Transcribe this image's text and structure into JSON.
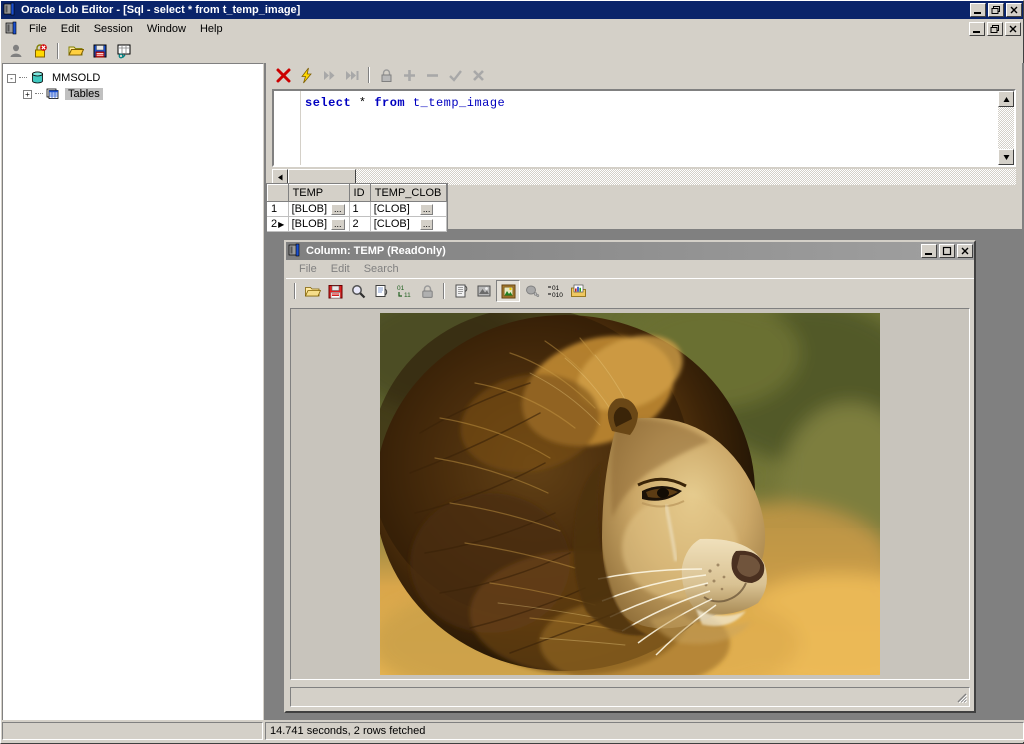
{
  "window": {
    "title": "Oracle Lob Editor - [Sql - select * from t_temp_image]",
    "app_icon": "lob-editor-icon",
    "buttons": {
      "minimize": "_",
      "maximize": "□",
      "close": "X"
    }
  },
  "menubar": {
    "mdi_icon": "document-icon",
    "items": [
      {
        "label": "File",
        "name": "menu-file"
      },
      {
        "label": "Edit",
        "name": "menu-edit"
      },
      {
        "label": "Session",
        "name": "menu-session"
      },
      {
        "label": "Window",
        "name": "menu-window"
      },
      {
        "label": "Help",
        "name": "menu-help"
      }
    ],
    "mdi_buttons": {
      "minimize": "_",
      "restore": "▭",
      "close": "X"
    }
  },
  "toolbar": {
    "buttons": [
      {
        "name": "user-icon",
        "title": "User"
      },
      {
        "name": "disconnect-lock-icon",
        "title": "Disconnect"
      },
      {
        "name": "open-folder-icon",
        "title": "Open"
      },
      {
        "name": "save-floppy-icon",
        "title": "Save"
      },
      {
        "name": "sql-grid-icon",
        "title": "New SQL"
      }
    ]
  },
  "tree": {
    "root": {
      "label": "MMSOLD",
      "icon": "database-icon",
      "expander": "-"
    },
    "child": {
      "label": "Tables",
      "icon": "tables-icon",
      "expander": "+",
      "selected": true
    }
  },
  "sql_window": {
    "toolbar": [
      {
        "name": "cancel-icon",
        "title": "Cancel"
      },
      {
        "name": "execute-lightning-icon",
        "title": "Execute"
      },
      {
        "name": "fetch-next-icon",
        "title": "Fetch next"
      },
      {
        "name": "fetch-all-icon",
        "title": "Fetch all"
      },
      {
        "name": "lock-icon",
        "title": "Lock"
      },
      {
        "name": "insert-plus-icon",
        "title": "Insert row"
      },
      {
        "name": "delete-minus-icon",
        "title": "Delete row"
      },
      {
        "name": "commit-check-icon",
        "title": "Commit"
      },
      {
        "name": "rollback-x-icon",
        "title": "Rollback"
      }
    ],
    "query_tokens": [
      {
        "text": "select",
        "kind": "keyword"
      },
      {
        "text": " ",
        "kind": "plain"
      },
      {
        "text": "*",
        "kind": "operator"
      },
      {
        "text": " ",
        "kind": "plain"
      },
      {
        "text": "from",
        "kind": "keyword"
      },
      {
        "text": " ",
        "kind": "plain"
      },
      {
        "text": "t_temp_image",
        "kind": "identifier"
      }
    ],
    "query_text": "select * from t_temp_image"
  },
  "grid": {
    "columns": [
      "TEMP",
      "ID",
      "TEMP_CLOB"
    ],
    "rows": [
      {
        "num": "1",
        "marker": "",
        "TEMP": "[BLOB]",
        "ID": "1",
        "TEMP_CLOB": "[CLOB]"
      },
      {
        "num": "2",
        "marker": "▶",
        "TEMP": "[BLOB]",
        "ID": "2",
        "TEMP_CLOB": "[CLOB]"
      }
    ],
    "ellipsis_label": "..."
  },
  "child_window": {
    "title": "Column: TEMP  (ReadOnly)",
    "icon": "lob-editor-icon",
    "buttons": {
      "minimize": "_",
      "maximize": "□",
      "close": "X"
    },
    "menu": [
      {
        "label": "File",
        "name": "child-menu-file"
      },
      {
        "label": "Edit",
        "name": "child-menu-edit"
      },
      {
        "label": "Search",
        "name": "child-menu-search"
      }
    ],
    "toolbar": [
      {
        "name": "open-folder-icon",
        "title": "Load from file"
      },
      {
        "name": "save-floppy-icon",
        "title": "Save to file"
      },
      {
        "name": "find-magnifier-icon",
        "title": "Find"
      },
      {
        "name": "copy-page-icon",
        "title": "Copy"
      },
      {
        "name": "convert-binary-icon",
        "title": "Convert"
      },
      {
        "name": "lock-icon",
        "title": "Read only"
      },
      {
        "name": "print-icon",
        "title": "Print"
      },
      {
        "name": "paint-edit-icon",
        "title": "Edit image"
      },
      {
        "name": "image-view-icon",
        "title": "Image view",
        "pressed": true
      },
      {
        "name": "object-view-icon",
        "title": "Object view"
      },
      {
        "name": "binary-view-icon",
        "title": "Binary view"
      },
      {
        "name": "report-view-icon",
        "title": "Report view"
      }
    ],
    "image": {
      "name": "lion-photo",
      "alt": "Lion portrait photograph"
    }
  },
  "statusbar": {
    "left": "",
    "right": "14.741 seconds,  2 rows fetched"
  },
  "colors": {
    "title_active": "#0a246a",
    "face": "#d4d0c8",
    "keyword": "#0000c0",
    "accent_red": "#cc0000",
    "accent_yellow": "#ffd800"
  }
}
